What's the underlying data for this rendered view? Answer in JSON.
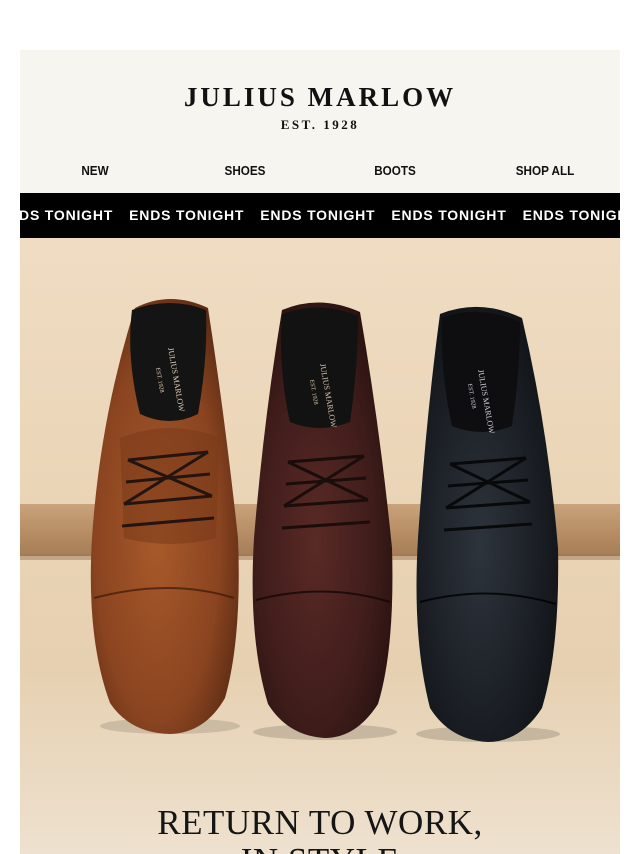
{
  "brand": {
    "name": "JULIUS MARLOW",
    "tagline": "EST. 1928"
  },
  "nav": {
    "items": [
      {
        "label": "NEW"
      },
      {
        "label": "SHOES"
      },
      {
        "label": "BOOTS"
      },
      {
        "label": "SHOP ALL"
      }
    ]
  },
  "ticker": {
    "text": "ENDS TONIGHT",
    "repeat_count": 6
  },
  "hero": {
    "image_alt": "Three cap-toe derby dress shoes in tan, dark brown and black on a wooden shelf",
    "shoe_insole_text": "JULIUS MARLOW",
    "shoe_insole_tagline": "EST. 1928",
    "headline_line1": "RETURN TO WORK,",
    "headline_line2": "IN STYLE"
  },
  "colors": {
    "background": "#ffffff",
    "email_bg": "#f7f5f0",
    "ticker_bg": "#000000",
    "ticker_text": "#ffffff",
    "hero_bg": "#ead4b6",
    "shoe_tan": "#8a4420",
    "shoe_brown": "#3e1c1a",
    "shoe_black": "#1a1e24",
    "shelf_wood": "#b88f66"
  }
}
